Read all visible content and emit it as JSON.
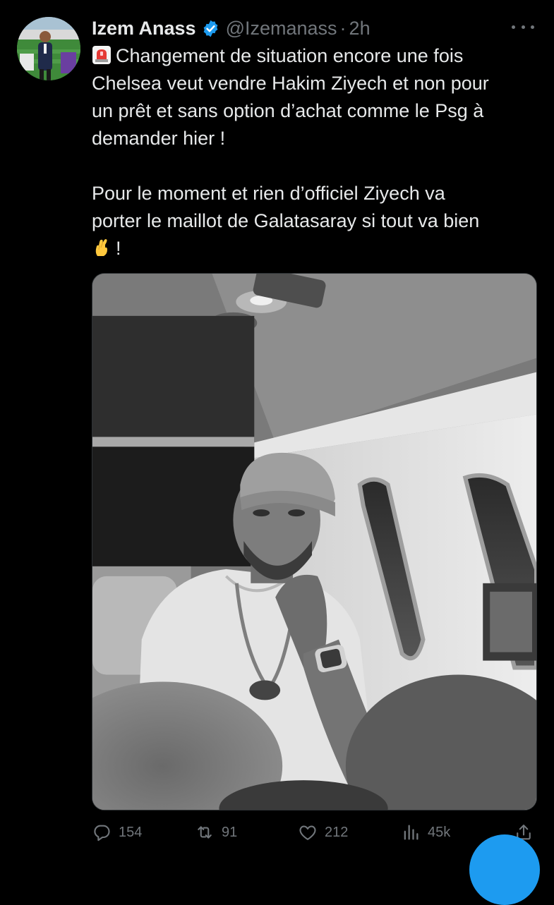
{
  "tweet": {
    "author": {
      "display_name": "Izem Anass",
      "handle": "@Izemanass",
      "verified": true
    },
    "separator": "·",
    "time": "2h",
    "text_lines": [
      "Changement de situation encore une fois",
      "Chelsea veut vendre Hakim Ziyech et non pour",
      "un prêt et sans option d’achat comme le Psg à",
      "demander hier !",
      "Pour le moment et rien d’officiel Ziyech va",
      "porter le maillot de Galatasaray si tout va bien",
      "!"
    ],
    "emojis": [
      "rotating-light-emoji",
      "crossed-fingers-emoji"
    ],
    "stats": {
      "replies": "154",
      "retweets": "91",
      "likes": "212",
      "views": "45k"
    }
  },
  "icons": {
    "more": "more-icon",
    "reply": "reply-icon",
    "retweet": "retweet-icon",
    "like": "heart-icon",
    "views": "views-icon",
    "share": "share-icon",
    "verified": "verified-badge-icon"
  },
  "colors": {
    "background": "#000000",
    "text": "#e7e9ea",
    "secondary": "#71767b",
    "verified": "#1d9bf0"
  }
}
